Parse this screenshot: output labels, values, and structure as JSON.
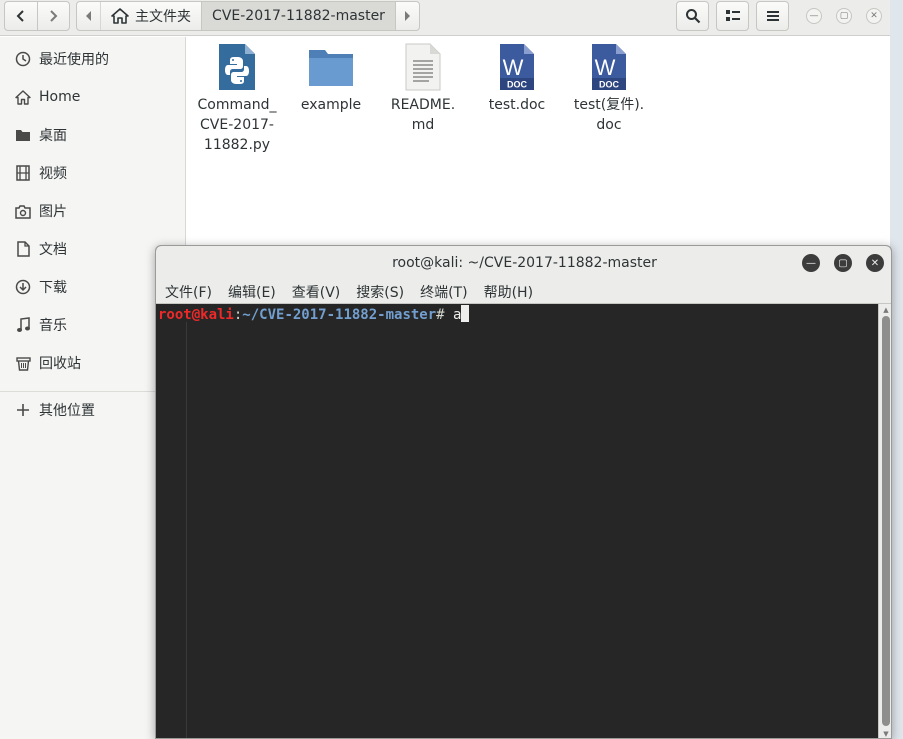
{
  "file_manager": {
    "path": {
      "home_label": "主文件夹",
      "current_label": "CVE-2017-11882-master"
    },
    "sidebar": [
      {
        "id": "recent",
        "label": "最近使用的",
        "icon": "clock-icon"
      },
      {
        "id": "home",
        "label": "Home",
        "icon": "home-icon"
      },
      {
        "id": "desktop",
        "label": "桌面",
        "icon": "folder-icon"
      },
      {
        "id": "videos",
        "label": "视频",
        "icon": "film-icon"
      },
      {
        "id": "pictures",
        "label": "图片",
        "icon": "camera-icon"
      },
      {
        "id": "documents",
        "label": "文档",
        "icon": "document-icon"
      },
      {
        "id": "downloads",
        "label": "下载",
        "icon": "download-icon"
      },
      {
        "id": "music",
        "label": "音乐",
        "icon": "music-icon"
      },
      {
        "id": "trash",
        "label": "回收站",
        "icon": "trash-icon"
      },
      {
        "id": "other",
        "label": "其他位置",
        "icon": "plus-icon"
      }
    ],
    "files": [
      {
        "name": "Command_\nCVE-2017-\n11882.py",
        "type": "python"
      },
      {
        "name": "example",
        "type": "folder"
      },
      {
        "name": "README.\nmd",
        "type": "text"
      },
      {
        "name": "test.doc",
        "type": "word"
      },
      {
        "name": "test(复件).\ndoc",
        "type": "word"
      }
    ],
    "doc_badge": "DOC",
    "word_letter": "W"
  },
  "terminal": {
    "title": "root@kali: ~/CVE-2017-11882-master",
    "menu": [
      "文件(F)",
      "编辑(E)",
      "查看(V)",
      "搜索(S)",
      "终端(T)",
      "帮助(H)"
    ],
    "prompt_user": "root@kali",
    "prompt_sep": ":",
    "prompt_path": "~/CVE-2017-11882-master",
    "prompt_hash": "#",
    "input": "a"
  },
  "colors": {
    "prompt_user": "#ef2929",
    "prompt_path": "#729fcf",
    "word_blue": "#3c5a9e",
    "python_blue": "#356c9e",
    "folder_blue": "#5d8fc5"
  }
}
